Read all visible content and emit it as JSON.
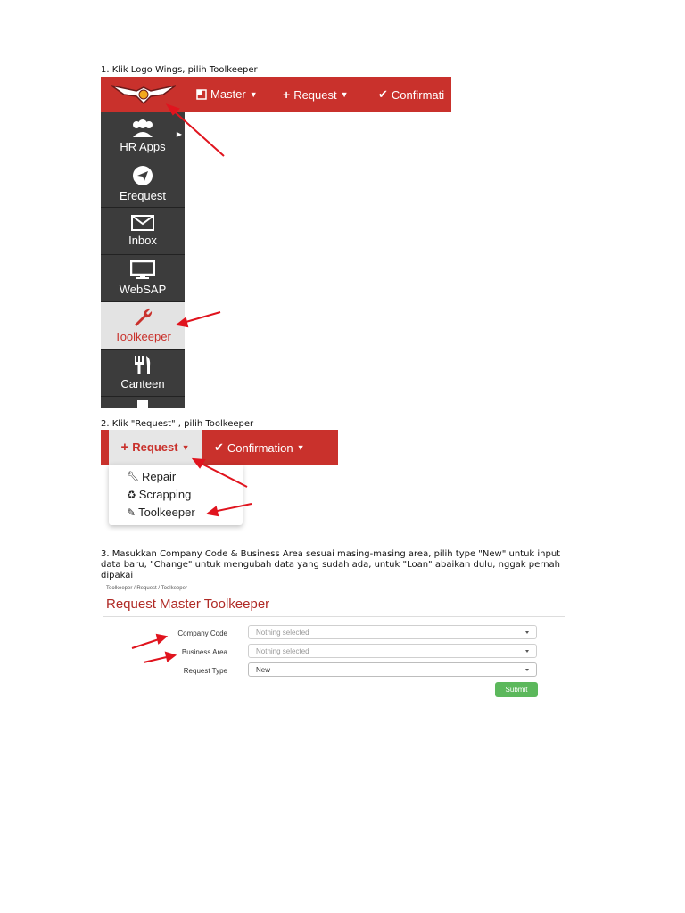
{
  "steps": {
    "s1": "1. Klik Logo Wings, pilih Toolkeeper",
    "s2": "2. Klik \"Request\" , pilih Toolkeeper",
    "s3_line1": "3. Masukkan Company Code & Business Area sesuai masing-masing area, pilih type \"New\" untuk input",
    "s3_line2": "data baru, \"Change\" untuk mengubah data yang sudah ada, untuk \"Loan\" abaikan dulu, nggak pernah",
    "s3_line3": "dipakai"
  },
  "shot1": {
    "nav": {
      "master": "Master",
      "request": "Request",
      "confirmation": "Confirmati"
    },
    "sidebar": [
      {
        "label": "HR Apps",
        "icon": "users-icon"
      },
      {
        "label": "Erequest",
        "icon": "send-icon"
      },
      {
        "label": "Inbox",
        "icon": "envelope-icon"
      },
      {
        "label": "WebSAP",
        "icon": "monitor-icon"
      },
      {
        "label": "Toolkeeper",
        "icon": "wrench-icon"
      },
      {
        "label": "Canteen",
        "icon": "cutlery-icon"
      }
    ]
  },
  "shot2": {
    "request": "Request",
    "confirmation": "Confirmation",
    "dropdown": [
      "Repair",
      "Scrapping",
      "Toolkeeper"
    ]
  },
  "shot3": {
    "breadcrumb": "Toolkeeper / Request / Toolkeeper",
    "title": "Request Master Toolkeeper",
    "fields": [
      {
        "label": "Company Code",
        "value": "Nothing selected"
      },
      {
        "label": "Business Area",
        "value": "Nothing selected"
      },
      {
        "label": "Request Type",
        "value": "New"
      }
    ],
    "submit": "Submit"
  },
  "colors": {
    "brand_red": "#c9312c",
    "sidebar_dark": "#3c3c3c",
    "submit_green": "#5cb85c",
    "arrow_red": "#e0141e"
  }
}
